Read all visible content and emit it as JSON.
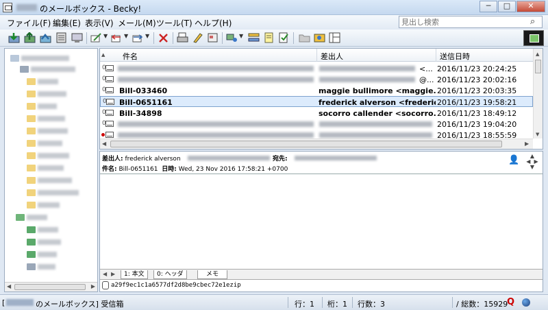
{
  "window": {
    "title": "のメールボックス - Becky!",
    "controls": {
      "minimize": "─",
      "maximize": "□",
      "close": "✕"
    }
  },
  "menu": [
    "ファイル(F)",
    "編集(E)",
    "表示(V)",
    "メール(M)",
    "ツール(T)",
    "ヘルプ(H)"
  ],
  "search": {
    "placeholder": "見出し検索",
    "icon": "search-icon"
  },
  "message_list": {
    "columns": [
      "件名",
      "差出人",
      "送信日時"
    ],
    "rows": [
      {
        "subject": "",
        "from": "<...",
        "date": "2016/11/23 20:24:25",
        "bold": false,
        "selected": false,
        "flag": ""
      },
      {
        "subject": "",
        "from": "@...",
        "date": "2016/11/23 20:02:16",
        "bold": false,
        "selected": false,
        "flag": ""
      },
      {
        "subject": "Bill-033460",
        "from": "maggie bullimore <maggie.bu...",
        "date": "2016/11/23 20:03:35",
        "bold": true,
        "selected": false,
        "flag": ""
      },
      {
        "subject": "Bill-0651161",
        "from": "frederick alverson <frederick....",
        "date": "2016/11/23 19:58:21",
        "bold": true,
        "selected": true,
        "flag": ""
      },
      {
        "subject": "Bill-34898",
        "from": "socorro callender <socorro.c...",
        "date": "2016/11/23 18:49:12",
        "bold": true,
        "selected": false,
        "flag": ""
      },
      {
        "subject": "",
        "from": "",
        "date": "2016/11/23 19:04:20",
        "bold": false,
        "selected": false,
        "flag": ""
      },
      {
        "subject": "",
        "from": "",
        "date": "2016/11/23 18:55:59",
        "bold": false,
        "selected": false,
        "flag": "red"
      }
    ]
  },
  "preview": {
    "from_label": "差出人:",
    "from_value": "frederick alverson",
    "to_label": "宛先:",
    "subject_label": "件名:",
    "subject_value": "Bill-0651161",
    "date_label": "日時:",
    "date_value": "Wed, 23 Nov 2016 17:58:21 +0700",
    "tabs": [
      "1: 本文",
      "0: ヘッダ",
      "メモ"
    ],
    "attachment": "a29f9ec1c1a6577df2d8be9cbec72e1ezip"
  },
  "status": {
    "mailbox": "のメールボックス] 受信箱",
    "line": "行：1",
    "col": "桁：1",
    "rows": "行数：3",
    "total": "/ 総数：15929",
    "q_icon": "Q"
  },
  "colors": {
    "selected_row": "#dcebfc",
    "close_button": "#c44a37",
    "accent": "#7da2ce"
  }
}
